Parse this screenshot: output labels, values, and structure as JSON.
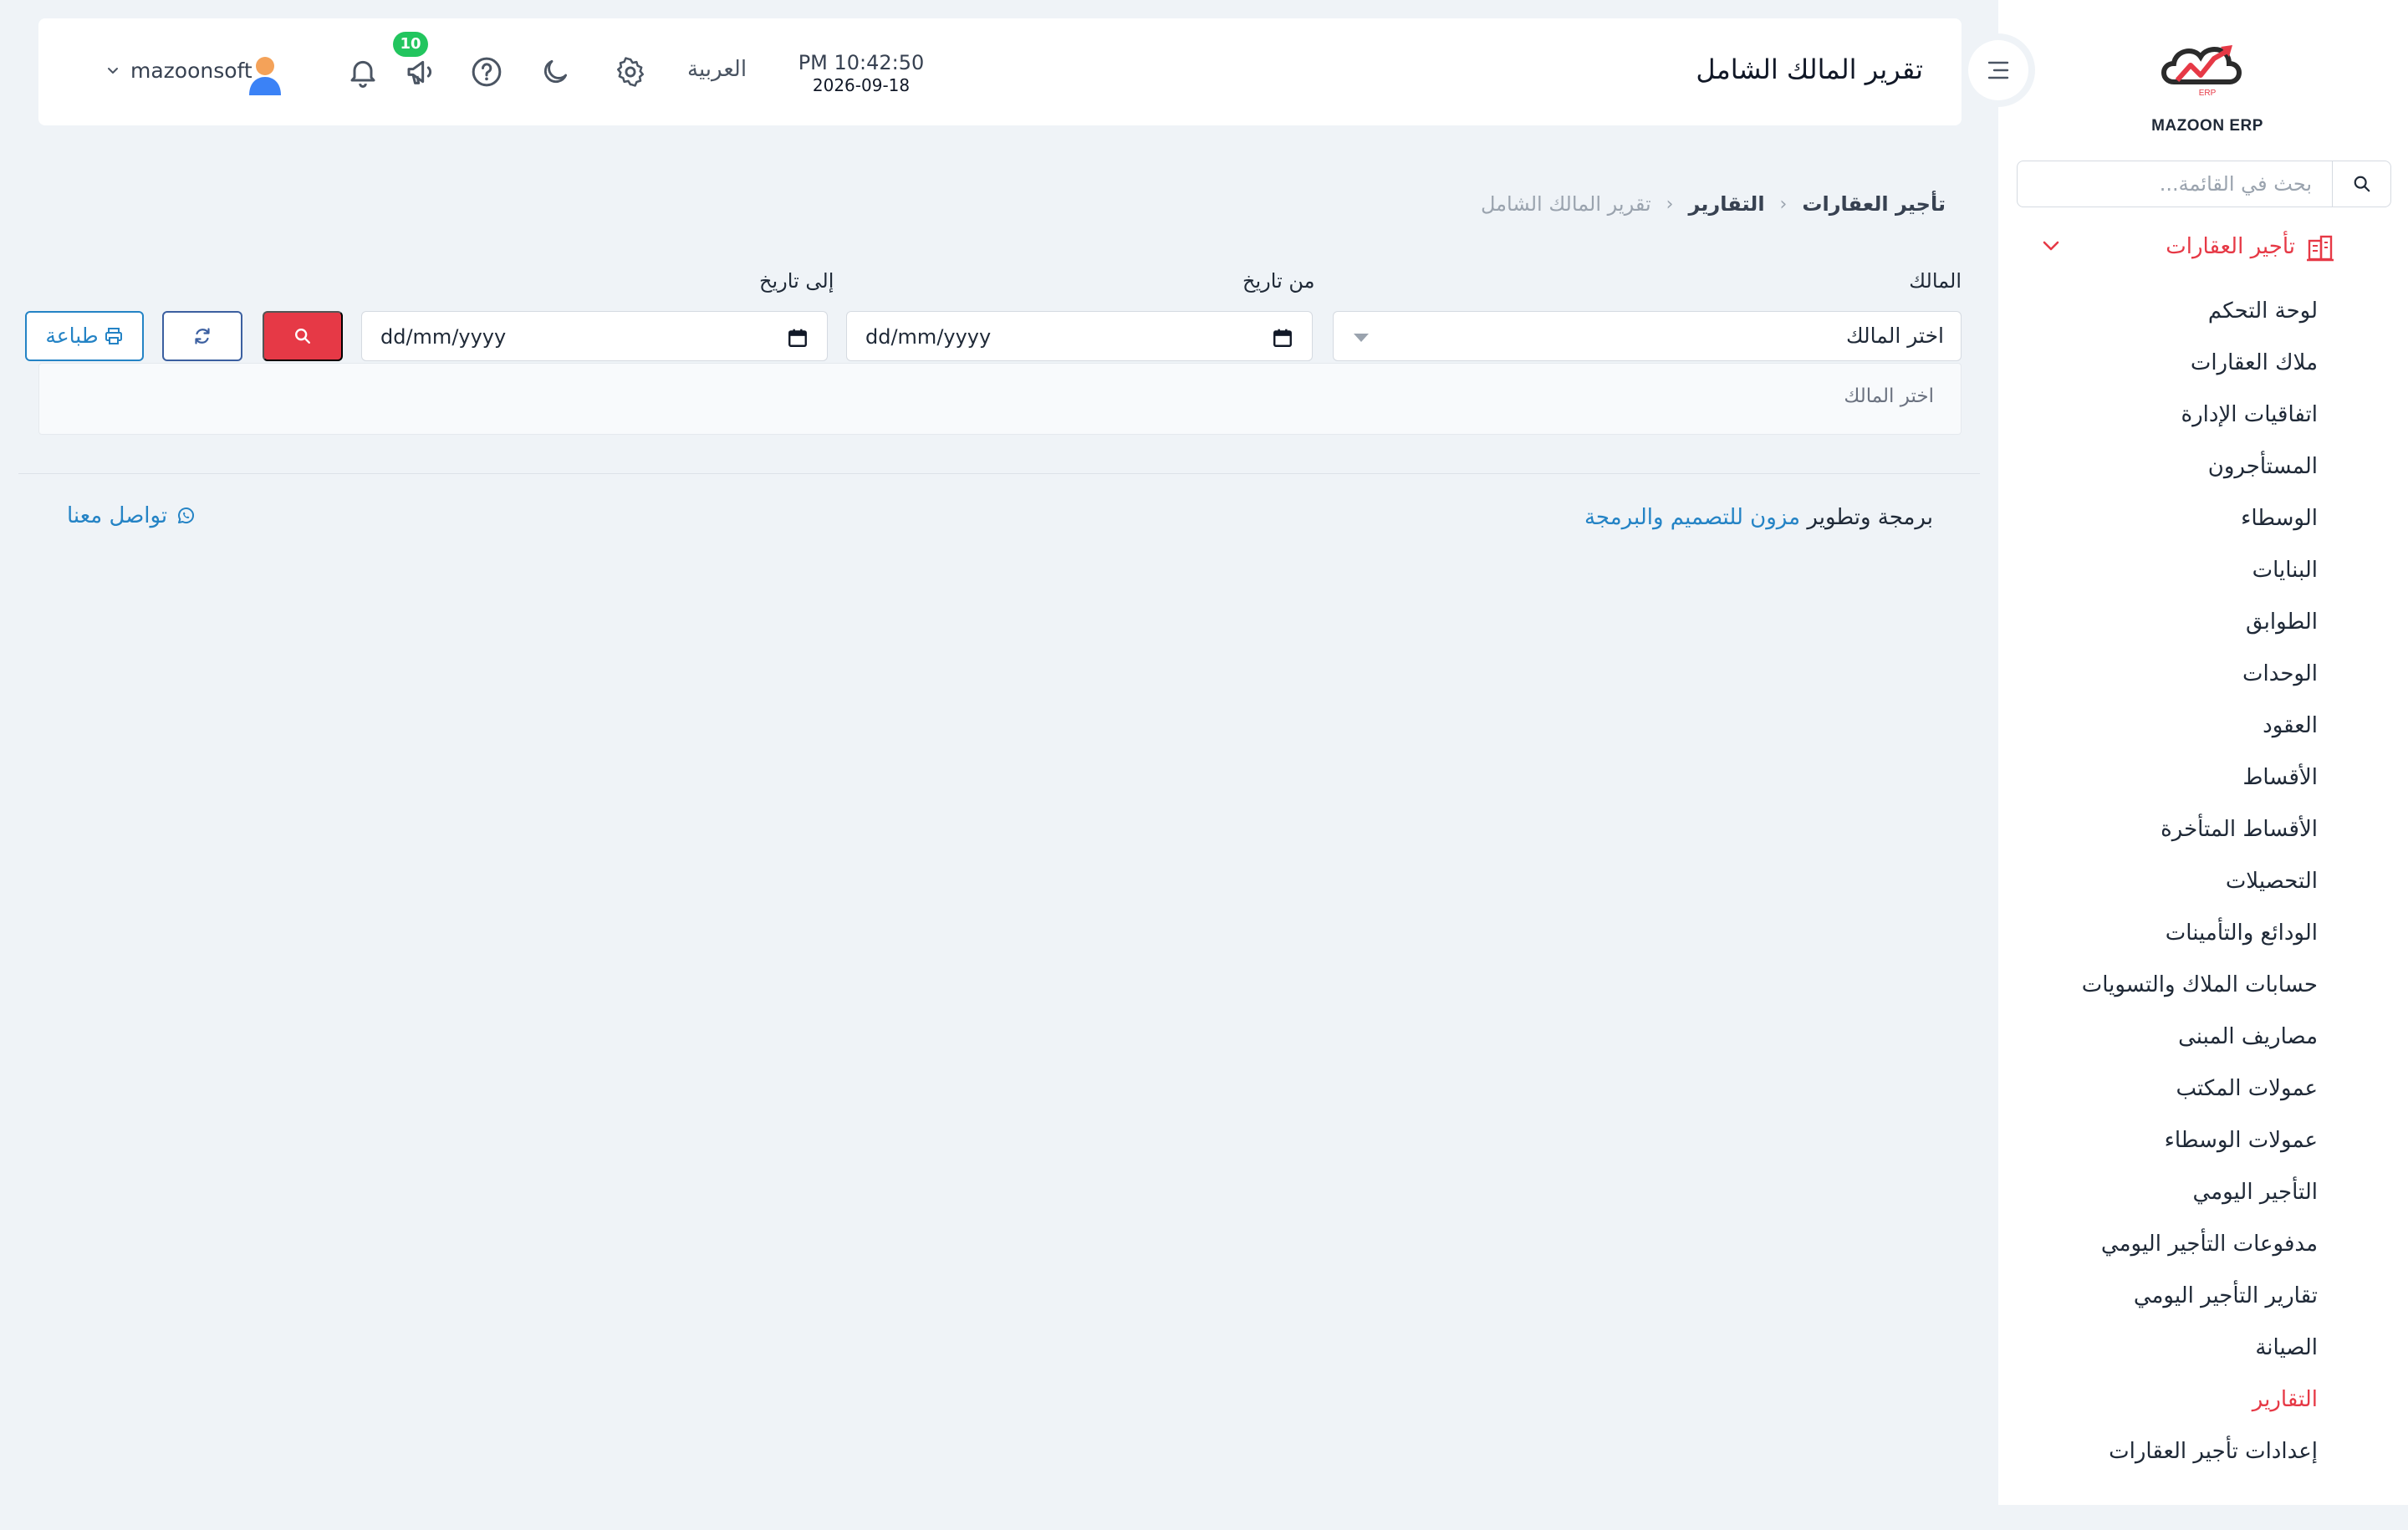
{
  "app": {
    "logo_text": "MAZOON ERP"
  },
  "sidebar": {
    "search_placeholder": "بحث في القائمة...",
    "group": {
      "label": "تأجير العقارات",
      "icon": "building-icon"
    },
    "items": [
      {
        "label": "لوحة التحكم"
      },
      {
        "label": "ملاك العقارات"
      },
      {
        "label": "اتفاقيات الإدارة"
      },
      {
        "label": "المستأجرون"
      },
      {
        "label": "الوسطاء"
      },
      {
        "label": "البنايات"
      },
      {
        "label": "الطوابق"
      },
      {
        "label": "الوحدات"
      },
      {
        "label": "العقود"
      },
      {
        "label": "الأقساط"
      },
      {
        "label": "الأقساط المتأخرة"
      },
      {
        "label": "التحصيلات"
      },
      {
        "label": "الودائع والتأمينات"
      },
      {
        "label": "حسابات الملاك والتسويات"
      },
      {
        "label": "مصاريف المبنى"
      },
      {
        "label": "عمولات المكتب"
      },
      {
        "label": "عمولات الوسطاء"
      },
      {
        "label": "التأجير اليومي"
      },
      {
        "label": "مدفوعات التأجير اليومي"
      },
      {
        "label": "تقارير التأجير اليومي"
      },
      {
        "label": "الصيانة"
      },
      {
        "label": "التقارير",
        "active": true
      },
      {
        "label": "إعدادات تأجير العقارات"
      }
    ]
  },
  "header": {
    "title": "تقرير المالك الشامل",
    "time": "PM 10:42:50",
    "date": "2026-09-18",
    "language": "العربية",
    "notifications_count": "10",
    "username": "mazoonsoft"
  },
  "breadcrumb": {
    "items": [
      "تأجير العقارات",
      "التقارير"
    ],
    "current": "تقرير المالك الشامل"
  },
  "filters": {
    "owner_label": "المالك",
    "owner_value": "اختر المالك",
    "from_label": "من تاريخ",
    "from_value": "dd/mm/yyyy",
    "to_label": "إلى تاريخ",
    "to_value": "dd/mm/yyyy",
    "print_label": "طباعة"
  },
  "result": {
    "message": "اختر المالك"
  },
  "footer": {
    "credit_prefix": "برمجة وتطوير",
    "credit_link": "مزون للتصميم والبرمجة",
    "contact_label": "تواصل معنا"
  },
  "colors": {
    "accent": "#e63946",
    "link": "#2483c5",
    "badge": "#22c55e",
    "background": "#eff3f7"
  }
}
